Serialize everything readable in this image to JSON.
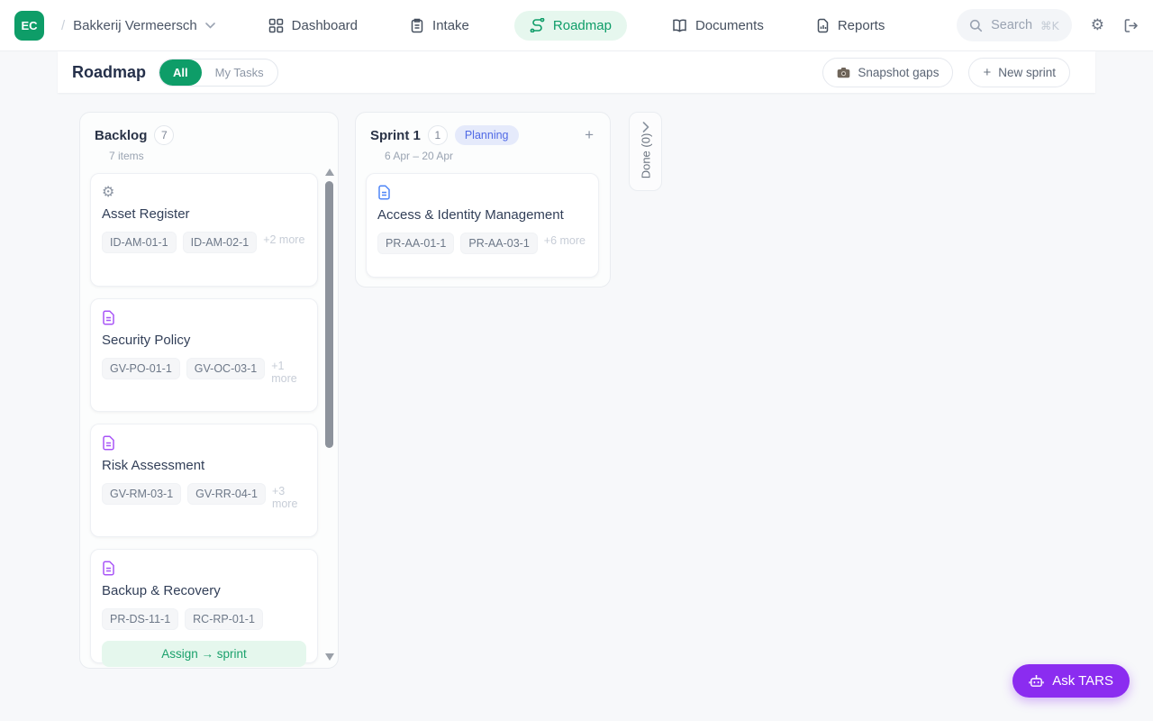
{
  "brand": {
    "logo": "EC"
  },
  "colors": {
    "green": "#0e9d68",
    "green_soft": "#e6f7ee",
    "purple": "#8b2cf0",
    "planning_bg": "#e5eafb",
    "planning_text": "#5069e5"
  },
  "icons": {
    "gear": "⚙",
    "plus": "+"
  },
  "topnav": {
    "breadcrumb_separator": "/",
    "org_name": "Bakkerij Vermeersch",
    "items": [
      "Dashboard",
      "Intake",
      "Roadmap",
      "Documents",
      "Reports"
    ],
    "search_placeholder": "Search",
    "search_shortcut": "⌘K"
  },
  "subheader": {
    "title": "Roadmap",
    "filter_all": "All",
    "filter_my_tasks": "My Tasks",
    "snapshot_button": "Snapshot gaps",
    "new_sprint_button": "New sprint"
  },
  "board": {
    "backlog": {
      "title": "Backlog",
      "count": "7",
      "subtitle": "7 items",
      "cards": [
        {
          "title": "Asset Register",
          "tags": [
            "ID-AM-01-1",
            "ID-AM-02-1"
          ],
          "more": "+2 more"
        },
        {
          "title": "Security Policy",
          "tags": [
            "GV-PO-01-1",
            "GV-OC-03-1"
          ],
          "more": "+1 more"
        },
        {
          "title": "Risk Assessment",
          "tags": [
            "GV-RM-03-1",
            "GV-RR-04-1"
          ],
          "more": "+3 more"
        },
        {
          "title": "Backup & Recovery",
          "tags": [
            "PR-DS-11-1",
            "RC-RP-01-1"
          ],
          "action": "Assign → sprint"
        }
      ]
    },
    "sprint": {
      "title": "Sprint 1",
      "count": "1",
      "status": "Planning",
      "subtitle": "6 Apr – 20 Apr",
      "cards": [
        {
          "title": "Access & Identity Management",
          "tags": [
            "PR-AA-01-1",
            "PR-AA-03-1"
          ],
          "more": "+6 more"
        }
      ]
    },
    "done": {
      "label": "Done (0)"
    }
  },
  "ask_tars": {
    "label": "Ask TARS"
  }
}
